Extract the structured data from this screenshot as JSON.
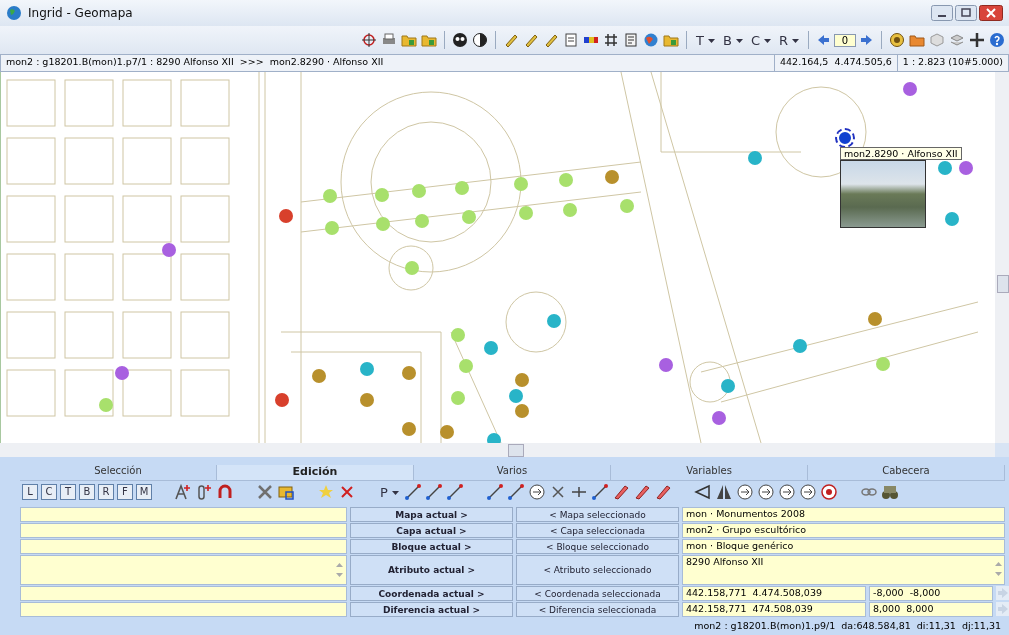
{
  "window": {
    "title": "Ingrid - Geomapa"
  },
  "toolbar": {
    "menus": [
      {
        "label": "T"
      },
      {
        "label": "B"
      },
      {
        "label": "C"
      },
      {
        "label": "R"
      }
    ],
    "page_field": "0"
  },
  "info_bar": {
    "path": "mon2 : g18201.B(mon)1.p7/1 : 8290 Alfonso XII  >>>  mon2.8290 · Alfonso XII",
    "coordinates": "442.164,5  4.474.505,6",
    "scale": "1 : 2.823 (10#5.000)"
  },
  "map": {
    "markers": [
      {
        "color": "#a860e0",
        "selected": false
      },
      {
        "color": "#a860e0",
        "selected": false
      },
      {
        "color": "#a860e0",
        "selected": false
      },
      {
        "color": "#a860e0",
        "selected": false
      },
      {
        "color": "#a860e0",
        "selected": false
      },
      {
        "color": "#a860e0",
        "selected": false
      },
      {
        "color": "#28b4c8",
        "selected": false
      },
      {
        "color": "#28b4c8",
        "selected": false
      },
      {
        "color": "#28b4c8",
        "selected": false
      },
      {
        "color": "#28b4c8",
        "selected": false
      },
      {
        "color": "#28b4c8",
        "selected": false
      },
      {
        "color": "#28b4c8",
        "selected": false
      },
      {
        "color": "#28b4c8",
        "selected": false
      },
      {
        "color": "#28b4c8",
        "selected": false
      },
      {
        "color": "#28b4c8",
        "selected": false
      },
      {
        "color": "#28b4c8",
        "selected": false
      },
      {
        "color": "#a8e06c",
        "selected": false
      },
      {
        "color": "#a8e06c",
        "selected": false
      },
      {
        "color": "#a8e06c",
        "selected": false
      },
      {
        "color": "#a8e06c",
        "selected": false
      },
      {
        "color": "#a8e06c",
        "selected": false
      },
      {
        "color": "#a8e06c",
        "selected": false
      },
      {
        "color": "#a8e06c",
        "selected": false
      },
      {
        "color": "#a8e06c",
        "selected": false
      },
      {
        "color": "#a8e06c",
        "selected": false
      },
      {
        "color": "#a8e06c",
        "selected": false
      },
      {
        "color": "#a8e06c",
        "selected": false
      },
      {
        "color": "#a8e06c",
        "selected": false
      },
      {
        "color": "#a8e06c",
        "selected": false
      },
      {
        "color": "#a8e06c",
        "selected": false
      },
      {
        "color": "#a8e06c",
        "selected": false
      },
      {
        "color": "#a8e06c",
        "selected": false
      },
      {
        "color": "#a8e06c",
        "selected": false
      },
      {
        "color": "#a8e06c",
        "selected": false
      },
      {
        "color": "#a8e06c",
        "selected": false
      },
      {
        "color": "#b8902c",
        "selected": false
      },
      {
        "color": "#b8902c",
        "selected": false
      },
      {
        "color": "#b8902c",
        "selected": false
      },
      {
        "color": "#b8902c",
        "selected": false
      },
      {
        "color": "#b8902c",
        "selected": false
      },
      {
        "color": "#b8902c",
        "selected": false
      },
      {
        "color": "#b8902c",
        "selected": false
      },
      {
        "color": "#b8902c",
        "selected": false
      },
      {
        "color": "#b8902c",
        "selected": false
      },
      {
        "color": "#d8402c",
        "selected": false
      },
      {
        "color": "#d8402c",
        "selected": false
      },
      {
        "color": "#1040d0",
        "selected": true
      }
    ],
    "tooltip": {
      "label": "mon2.8290 · Alfonso XII"
    }
  },
  "tabs": [
    {
      "label": "Selección",
      "selected": false
    },
    {
      "label": "Edición",
      "selected": true
    },
    {
      "label": "Varios",
      "selected": false
    },
    {
      "label": "Variables",
      "selected": false
    },
    {
      "label": "Cabecera",
      "selected": false
    }
  ],
  "edit_toolbar": {
    "letter_buttons": [
      "L",
      "C",
      "T",
      "B",
      "R",
      "F",
      "M"
    ],
    "menu": "P"
  },
  "rows": [
    {
      "kind": "single",
      "action": "Mapa actual >",
      "pick": "< Mapa seleccionado",
      "value": "mon · Monumentos 2008"
    },
    {
      "kind": "single",
      "action": "Capa actual >",
      "pick": "< Capa seleccionada",
      "value": "mon2 · Grupo escultórico"
    },
    {
      "kind": "single",
      "action": "Bloque actual >",
      "pick": "< Bloque seleccionado",
      "value": "mon · Bloque genérico"
    },
    {
      "kind": "multiline",
      "action": "Atributo actual >",
      "pick": "< Atributo seleccionado",
      "value": "8290 Alfonso XII"
    },
    {
      "kind": "pair",
      "action": "Coordenada actual >",
      "pick": "< Coordenada seleccionada",
      "value": "442.158,771  4.474.508,039",
      "offset": "-8,000  -8,000"
    },
    {
      "kind": "pair",
      "action": "Diferencia actual >",
      "pick": "< Diferencia seleccionada",
      "value": "442.158,771  474.508,039",
      "offset": "8,000  8,000"
    }
  ],
  "status_bar": "mon2 : g18201.B(mon)1.p9/1  da:648.584,81  di:11,31  dj:11,31"
}
